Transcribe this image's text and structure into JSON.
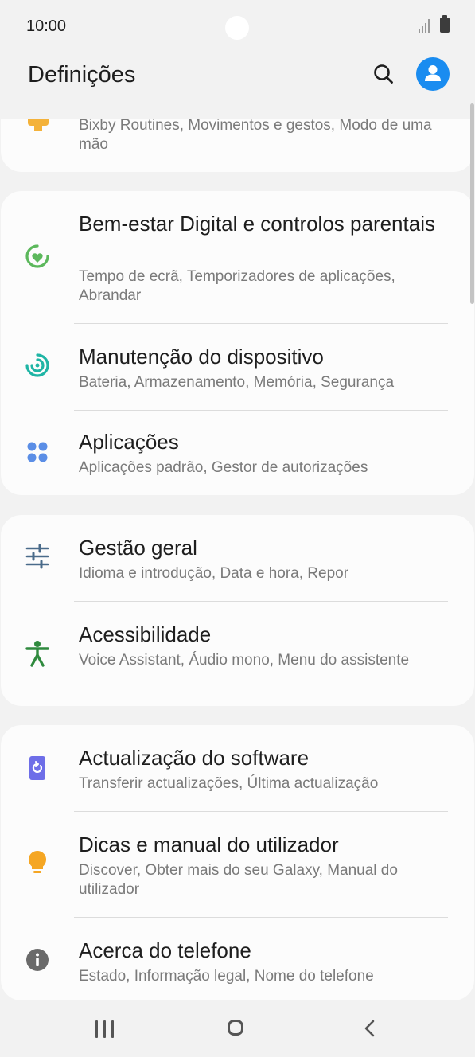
{
  "status": {
    "time": "10:00"
  },
  "header": {
    "title": "Definições"
  },
  "partial_item": {
    "subtitle": "Bixby Routines, Movimentos e gestos, Modo de uma mão"
  },
  "group1": [
    {
      "title": "Bem-estar Digital e controlos parentais",
      "subtitle": "Tempo de ecrã, Temporizadores de aplicações, Abrandar",
      "icon": "digital-wellbeing-icon",
      "color": "#5cb85c"
    },
    {
      "title": "Manutenção do dispositivo",
      "subtitle": "Bateria, Armazenamento, Memória, Segurança",
      "icon": "device-care-icon",
      "color": "#1fb5a5"
    },
    {
      "title": "Aplicações",
      "subtitle": "Aplicações padrão, Gestor de autorizações",
      "icon": "apps-icon",
      "color": "#5b8ee6"
    }
  ],
  "group2": [
    {
      "title": "Gestão geral",
      "subtitle": "Idioma e introdução, Data e hora, Repor",
      "icon": "sliders-icon",
      "color": "#4a6b8a"
    },
    {
      "title": "Acessibilidade",
      "subtitle": "Voice Assistant, Áudio mono, Menu do assistente",
      "icon": "accessibility-icon",
      "color": "#2f8a3e"
    }
  ],
  "group3": [
    {
      "title": "Actualização do software",
      "subtitle": "Transferir actualizações, Última actualização",
      "icon": "software-update-icon",
      "color": "#6e6ee8"
    },
    {
      "title": "Dicas e manual do utilizador",
      "subtitle": "Discover, Obter mais do seu Galaxy, Manual do utilizador",
      "icon": "lightbulb-icon",
      "color": "#f5a623"
    },
    {
      "title": "Acerca do telefone",
      "subtitle": "Estado, Informação legal, Nome do telefone",
      "icon": "info-icon",
      "color": "#6a6a6a"
    }
  ]
}
